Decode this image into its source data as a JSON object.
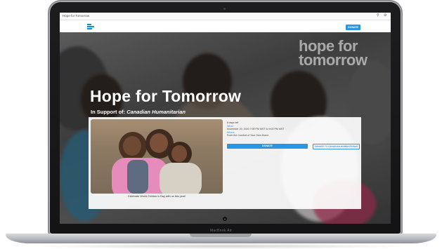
{
  "browser": {
    "tab_title": "Hope for Tomorrow",
    "search_icon": "search-icon",
    "settings_icon": "gear-icon"
  },
  "header": {
    "logo_icon": "logo-stripes-icon",
    "donate_label": "DONATE"
  },
  "hero": {
    "background_text": "hope for tomorrow",
    "title": "Hope for Tomorrow",
    "support_prefix": "In Support of:",
    "support_org": "Canadian Humanitarian"
  },
  "card": {
    "photo_caption": "Celebrate World Children's Day with us this year!",
    "days_left": "8 days left",
    "when_label": "When",
    "when_value": "November 20, 2020 7:00 PM MST to 9:00 PM MST",
    "where_label": "Where",
    "where_value": "From the Comfort of Your Own Home",
    "donate_label": "DONATE",
    "donate_org_label": "DONATE TO CANADIAN HUMANITARIAN"
  },
  "device": {
    "model": "MacBook Air"
  },
  "colors": {
    "accent": "#2a95e0"
  }
}
